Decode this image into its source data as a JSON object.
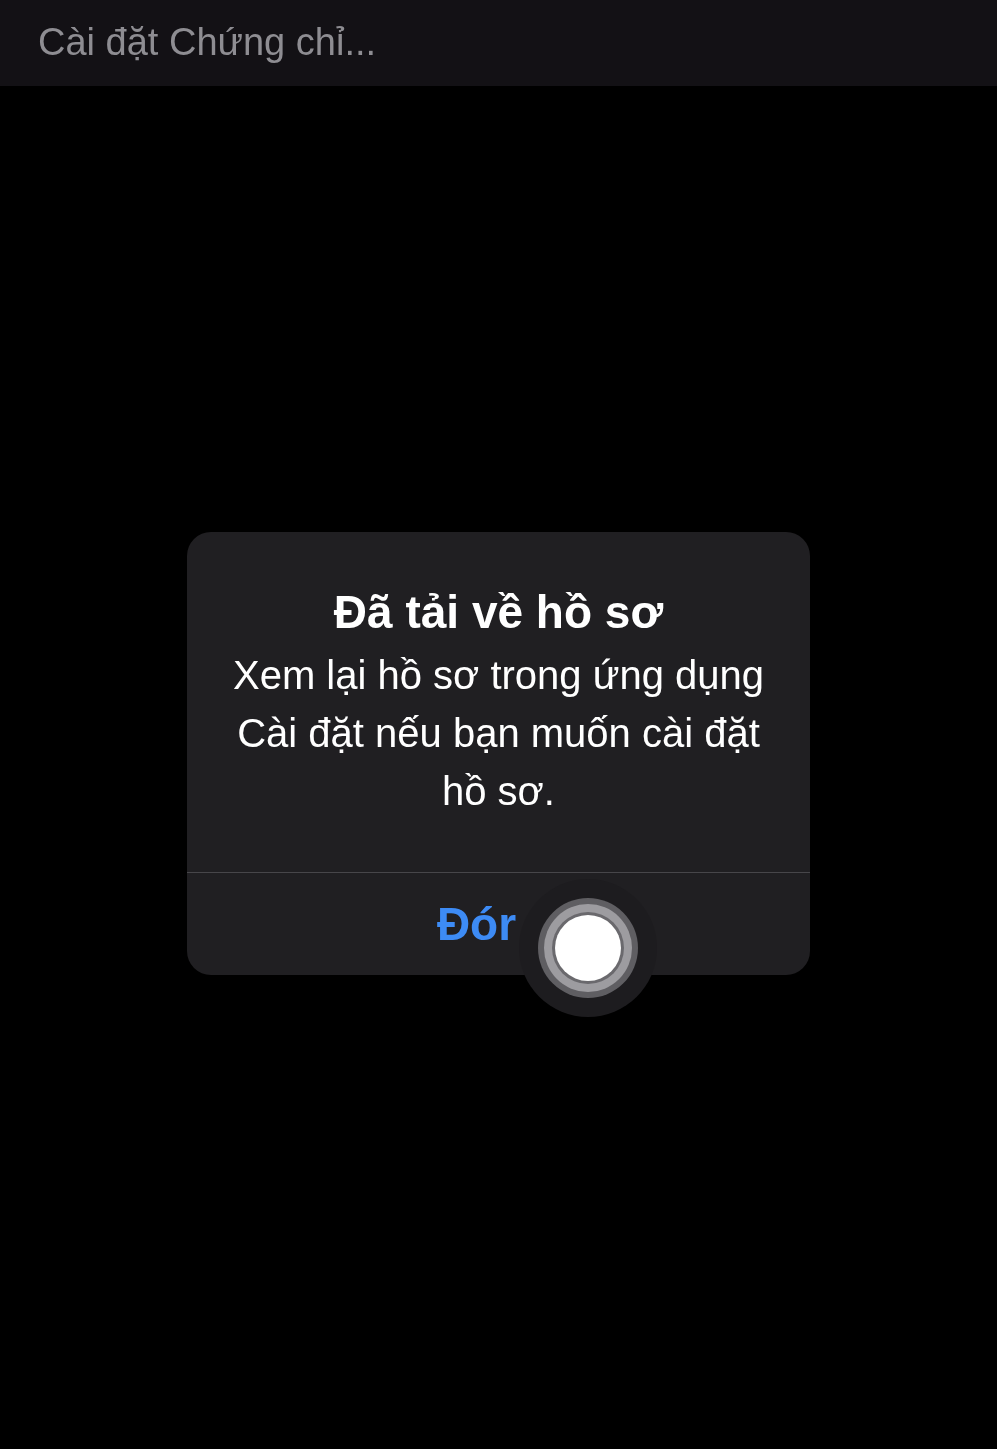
{
  "header": {
    "title": "Cài đặt Chứng chỉ..."
  },
  "alert": {
    "title": "Đã tải về hồ sơ",
    "message": "Xem lại hồ sơ trong ứng dụng Cài đặt nếu bạn muốn cài đặt hồ sơ.",
    "buttons": [
      {
        "label": "Đór"
      }
    ]
  }
}
